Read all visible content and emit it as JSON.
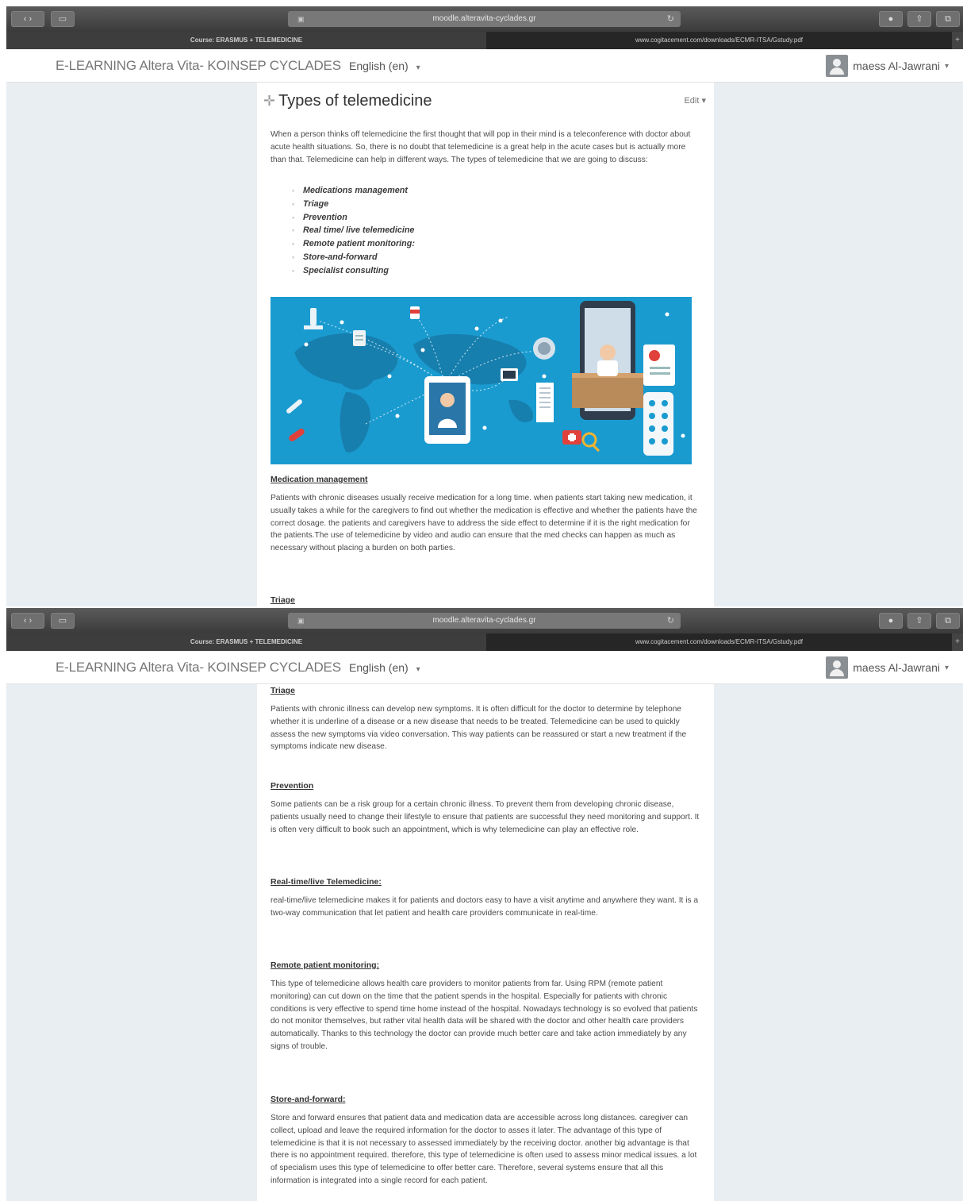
{
  "browser": {
    "address": "moodle.alteravita-cyclades.gr",
    "tab_active": "Course: ERASMUS + TELEMEDICINE",
    "tab_other": "www.cogitacement.com/downloads/ECMR-ITSA/Gstudy.pdf"
  },
  "navbar": {
    "site_name": "E-LEARNING Altera Vita- KOINSEP CYCLADES",
    "language": "English (en)",
    "user_name": "maess Al-Jawrani"
  },
  "page": {
    "title": "Types of telemedicine",
    "edit_label": "Edit",
    "intro": "When a person thinks off telemedicine the first thought that will pop in their mind is a teleconference with doctor about acute health situations. So, there is no doubt that telemedicine is a great help in the acute cases but is actually more than that. Telemedicine can help in different ways. The types of telemedicine  that we are going to discuss:",
    "types": [
      "Medications management",
      "Triage",
      "Prevention",
      "Real time/ live telemedicine",
      "Remote patient monitoring:",
      "Store-and-forward",
      "Specialist consulting"
    ],
    "sections": {
      "medication": {
        "heading": "Medication management",
        "text": " Patients with chronic diseases usually receive medication for a long time. when patients start taking new medication, it usually takes a while for the caregivers to find out whether the medication is effective and whether the patients have the correct dosage. the patients and caregivers have to address the side effect to determine if it is the right medication for the patients.The use of telemedicine by video and audio can ensure that the med checks can happen as much as necessary without placing a burden on both parties."
      },
      "triage": {
        "heading": "Triage",
        "text": " Patients with chronic illness can develop new symptoms. It is often difficult for the doctor to determine by telephone whether it is underline of a disease or a new disease that needs to be treated. Telemedicine can be used to quickly assess the new symptoms via video conversation. This way patients can be reassured or start a new treatment if the symptoms indicate new disease."
      },
      "prevention": {
        "heading": "Prevention",
        "text": "Some patients can be a risk group for a certain chronic illness. To prevent them from developing chronic disease, patients usually need to change their lifestyle to ensure that patients are successful they need monitoring and support. It is often very difficult to book such an appointment, which is why telemedicine can play an effective role."
      },
      "realtime": {
        "heading": "Real-time/live Telemedicine:",
        "text": "real-time/live telemedicine makes it for patients and doctors easy to have a visit anytime and anywhere they want. It is a two-way communication that let patient and health care providers communicate in real-time."
      },
      "remote": {
        "heading": "Remote patient monitoring:",
        "text": "This type of telemedicine allows health care providers to monitor patients from far. Using RPM (remote patient monitoring) can cut down on the time that the patient spends in the hospital. Especially for patients with chronic conditions is very effective to spend time home instead of the hospital. Nowadays technology is so evolved that patients do not monitor themselves, but rather vital health data will be shared with the doctor and other health care providers automatically. Thanks to this technology the doctor can provide much better care and take action immediately by any signs of trouble."
      },
      "store": {
        "heading": "Store-and-forward:",
        "text": "Store and forward ensures that patient data and medication data are accessible across long distances. caregiver can collect, upload and leave the required information for the doctor to asses it later. The advantage of this type of telemedicine is that it is not necessary to assessed immediately by the receiving doctor. another big advantage is that there is no appointment required. therefore, this type of telemedicine is often used to assess minor medical issues. a lot of specialism uses this type of telemedicine to offer better care. Therefore, several systems ensure that all this information is integrated into a single record for each patient."
      }
    }
  },
  "colors": {
    "page_bg": "#e9eef2",
    "hero_bg": "#1a9bd0",
    "chrome": "#3b3b3b"
  }
}
